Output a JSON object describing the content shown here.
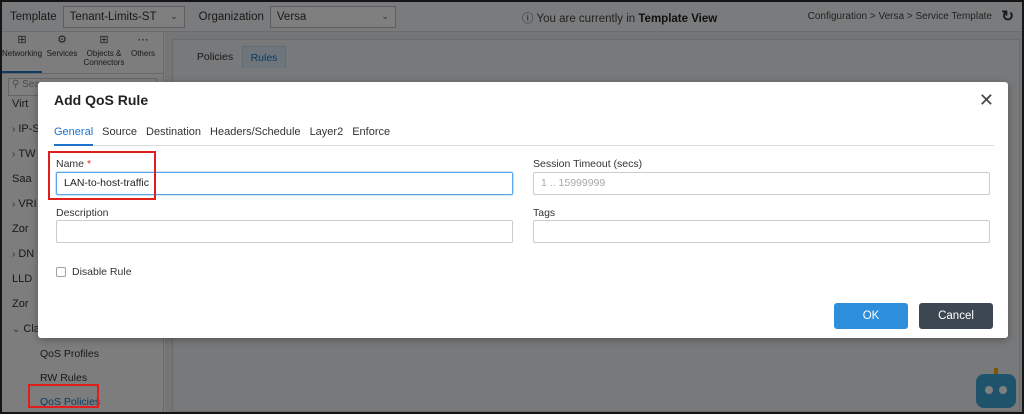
{
  "topbar": {
    "template_label": "Template",
    "template_value": "Tenant-Limits-ST",
    "org_label": "Organization",
    "org_value": "Versa",
    "center_prefix": "You are currently in",
    "center_view": "Template View",
    "breadcrumb": "Configuration  >  Versa  >  Service Template"
  },
  "sidebar": {
    "tabs": [
      {
        "label": "Networking",
        "icon": "networking-icon"
      },
      {
        "label": "Services",
        "icon": "services-icon"
      },
      {
        "label": "Objects & Connectors",
        "icon": "objects-icon"
      },
      {
        "label": "Others",
        "icon": "more-icon"
      }
    ],
    "search_placeholder": "Sea",
    "items": [
      "Virt",
      "IP-S",
      "TW",
      "Saa",
      "VRI",
      "Zor",
      "DN",
      "LLD",
      "Zor",
      "Clas"
    ],
    "sub_items": [
      "QoS Profiles",
      "RW Rules",
      "QoS Policies"
    ]
  },
  "content_tabs": [
    "Policies",
    "Rules"
  ],
  "modal": {
    "title": "Add QoS Rule",
    "tabs": [
      "General",
      "Source",
      "Destination",
      "Headers/Schedule",
      "Layer2",
      "Enforce"
    ],
    "active_tab": "General",
    "name_label": "Name",
    "name_required": "*",
    "name_value": "LAN-to-host-traffic",
    "session_timeout_label": "Session Timeout (secs)",
    "session_timeout_placeholder": "1 .. 15999999",
    "description_label": "Description",
    "description_value": "",
    "tags_label": "Tags",
    "tags_value": "",
    "disable_rule_label": "Disable Rule",
    "disable_rule_checked": false,
    "ok_label": "OK",
    "cancel_label": "Cancel"
  },
  "colors": {
    "accent": "#1a73c9",
    "ok_button": "#2d8fdb",
    "cancel_button": "#3d4751",
    "highlight_box": "#e01e1e"
  }
}
